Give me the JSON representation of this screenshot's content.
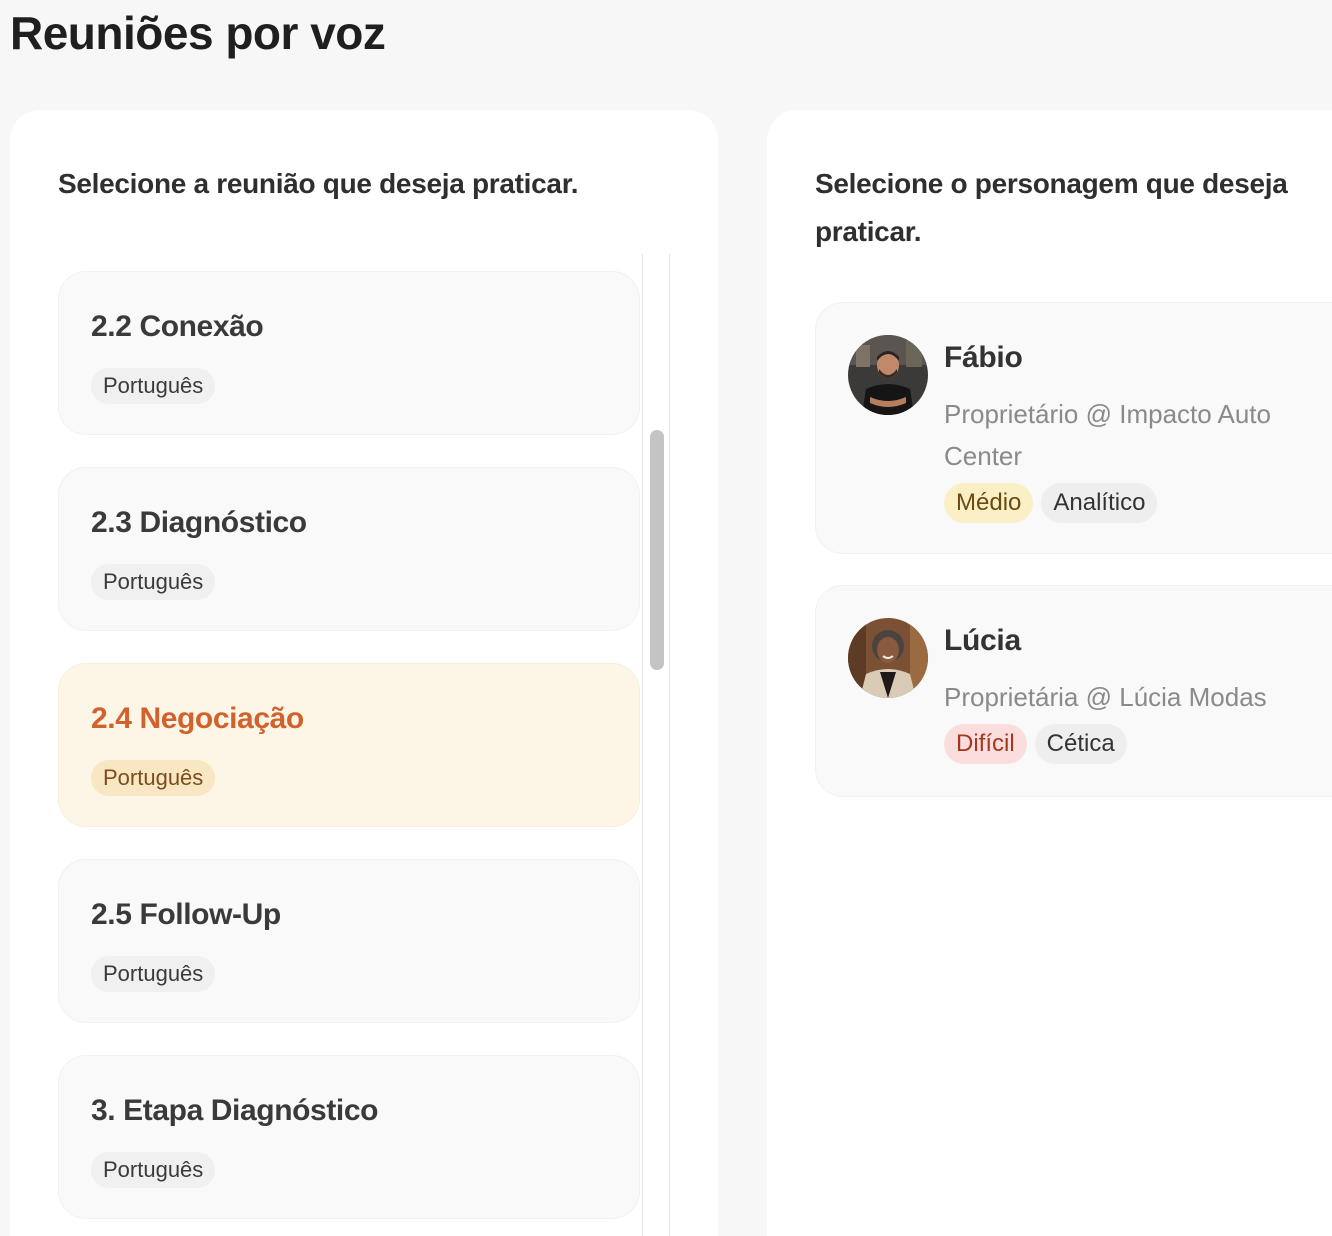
{
  "page": {
    "title": "Reuniões por voz"
  },
  "meetings_panel": {
    "heading": "Selecione a reunião que deseja praticar.",
    "items": [
      {
        "title": "2.2 Conexão",
        "language": "Português",
        "selected": false
      },
      {
        "title": "2.3 Diagnóstico",
        "language": "Português",
        "selected": false
      },
      {
        "title": "2.4 Negociação",
        "language": "Português",
        "selected": true
      },
      {
        "title": "2.5 Follow-Up",
        "language": "Português",
        "selected": false
      },
      {
        "title": "3. Etapa Diagnóstico",
        "language": "Português",
        "selected": false
      }
    ]
  },
  "personas_panel": {
    "heading": "Selecione o personagem que deseja praticar.",
    "items": [
      {
        "name": "Fábio",
        "role": "Proprietário @ Impacto Auto Center",
        "difficulty": "Médio",
        "profile": "Analítico",
        "difficulty_color": "#fbefc6",
        "avatar_icon": "man-portrait-icon"
      },
      {
        "name": "Lúcia",
        "role": "Proprietária @ Lúcia Modas",
        "difficulty": "Difícil",
        "profile": "Cética",
        "difficulty_color": "#fbdddd",
        "avatar_icon": "woman-portrait-icon"
      }
    ]
  },
  "colors": {
    "accent": "#d2622d",
    "selected_bg": "#fdf6e6"
  }
}
